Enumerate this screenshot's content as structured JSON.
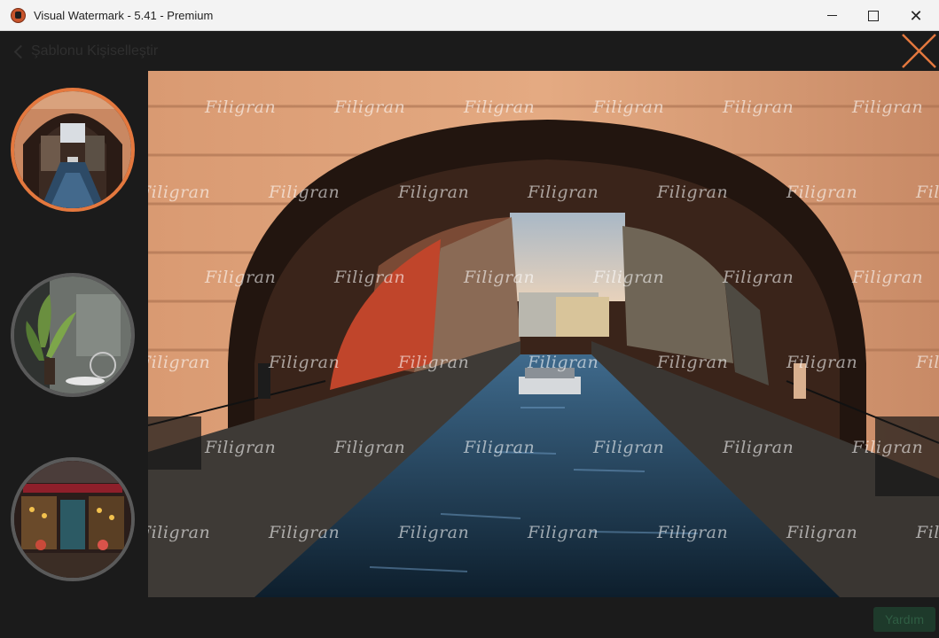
{
  "window": {
    "title": "Visual Watermark - 5.41 - Premium",
    "minimize": "–",
    "maximize": "□",
    "close": "✕"
  },
  "header": {
    "back_label": "Şablonu Kişiselleştir",
    "back_icon": "chevron-left-icon",
    "close_icon": "close-icon"
  },
  "thumbnails": [
    {
      "name": "canal-arch",
      "selected": true
    },
    {
      "name": "plant-interior",
      "selected": false
    },
    {
      "name": "cafe-front",
      "selected": false
    }
  ],
  "preview": {
    "watermark_text": "Filigran",
    "watermark_rows": 6,
    "watermark_cols": 7
  },
  "footer": {
    "help_label": "Yardım"
  },
  "colors": {
    "accent": "#e4783e",
    "background": "#1b1b1b",
    "titlebar": "#f3f3f3"
  }
}
